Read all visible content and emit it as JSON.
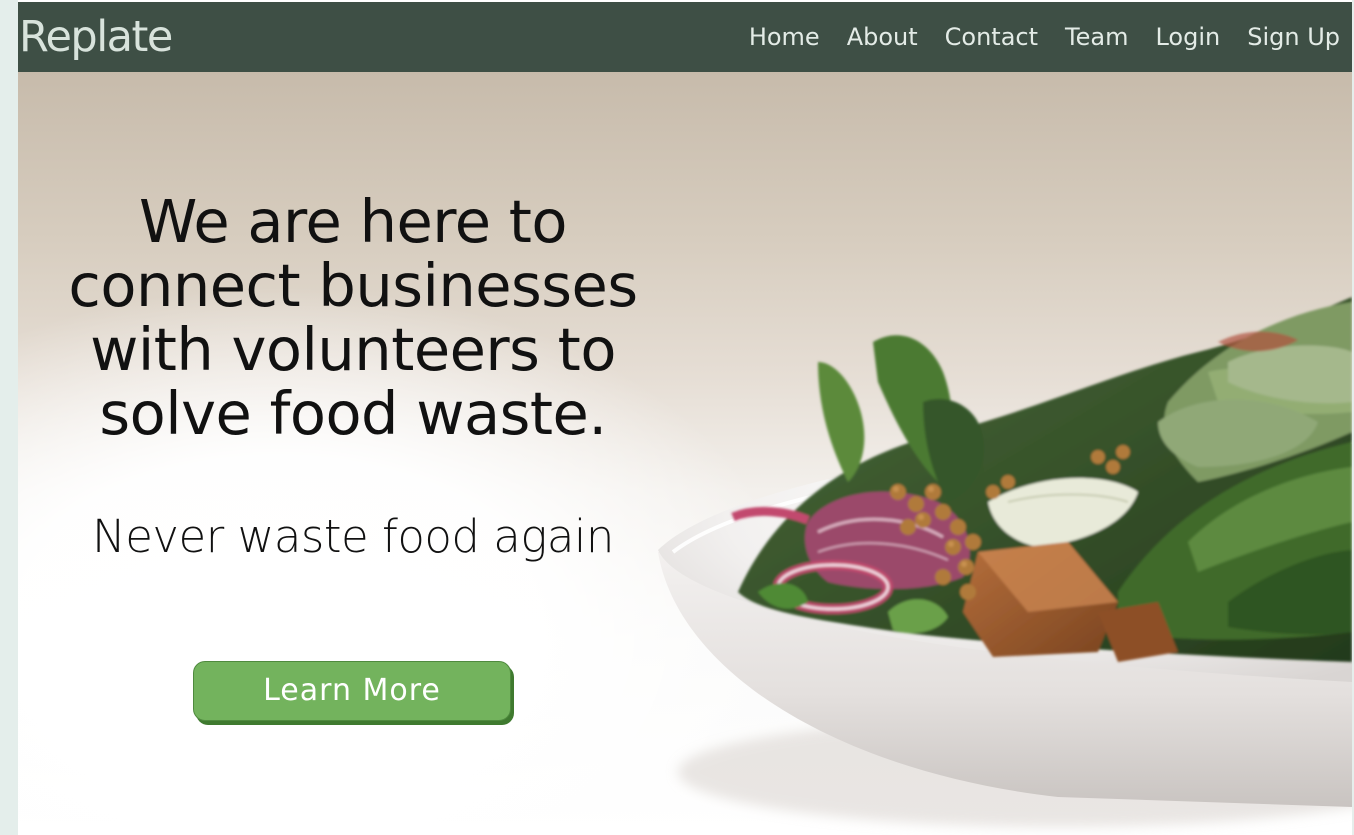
{
  "brand": {
    "name": "Replate"
  },
  "nav": {
    "items": [
      {
        "label": "Home"
      },
      {
        "label": "About"
      },
      {
        "label": "Contact"
      },
      {
        "label": "Team"
      },
      {
        "label": "Login"
      },
      {
        "label": "Sign Up"
      }
    ]
  },
  "hero": {
    "headline": "We are here to connect businesses with volunteers to solve food waste.",
    "subheading": "Never waste food again",
    "cta_label": "Learn More",
    "image_subject": "salad-bowl-photo"
  },
  "colors": {
    "navbar_bg": "#3e4f45",
    "nav_text": "#e3ebe6",
    "cta_bg": "#73b35d",
    "cta_shadow": "#3f7a2f",
    "page_side_strip": "#e4eeeb"
  }
}
